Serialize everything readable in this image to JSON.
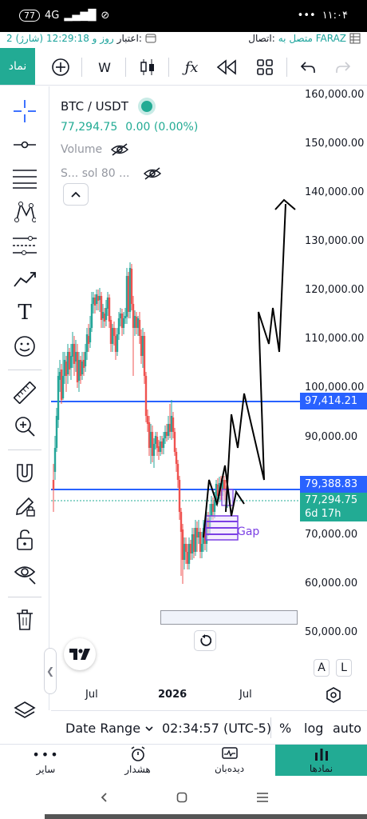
{
  "status": {
    "badge": "77",
    "network": "4G",
    "time": "۱۱:۰۴",
    "dots": "•••"
  },
  "conn": {
    "label": "اتصال:",
    "value": "متصل به FARAZ",
    "credit_label": "اعتبار:",
    "credit_value": "2 روز و 12:29:18 (شارژ)"
  },
  "toolbar": {
    "symbol": "نماد",
    "interval": "W"
  },
  "legend": {
    "pair": "BTC / USDT",
    "price": "77,294.75",
    "change": "0.00 (0.00%)",
    "volume": "Volume",
    "study": "S... sol 80 ..."
  },
  "price_axis": [
    "160,000.00",
    "150,000.00",
    "140,000.00",
    "130,000.00",
    "120,000.00",
    "110,000.00",
    "100,000.00",
    "90,000.00",
    "70,000.00",
    "60,000.00",
    "50,000.00"
  ],
  "price_tags": {
    "level1": "97,414.21",
    "level2": "79,388.83",
    "last": "77,294.75",
    "countdown": "6d 17h"
  },
  "colors": {
    "level": "#2962ff",
    "last": "#22ab94",
    "up": "#26a69a",
    "down": "#ef5350",
    "drawing": "#000000",
    "gap": "#7b3fe4"
  },
  "annotation": "Gap",
  "time_axis": [
    "Jul",
    "2026",
    "Jul"
  ],
  "scale_buttons": {
    "a": "A",
    "l": "L"
  },
  "bottom": {
    "range": "Date Range",
    "clock": "02:34:57 (UTC-5)",
    "pct": "%",
    "log": "log",
    "auto": "auto"
  },
  "tabs": [
    "سایر",
    "هشدار",
    "دیده‌بان",
    "نمادها"
  ]
}
